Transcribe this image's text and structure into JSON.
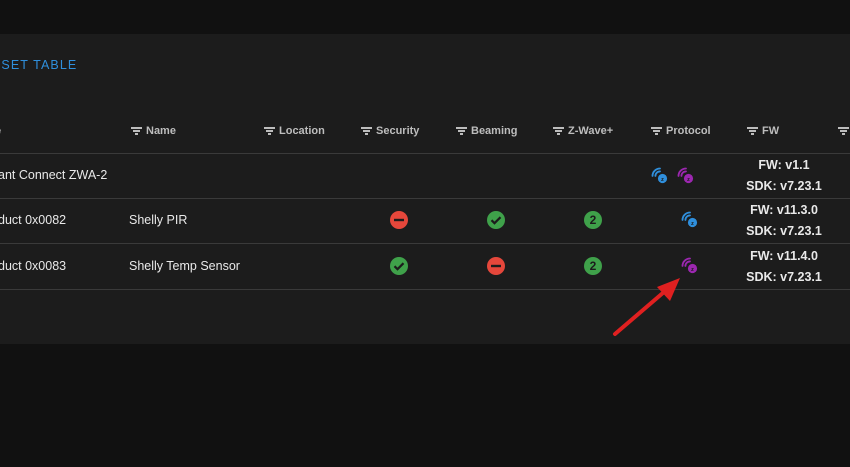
{
  "toolbar": {
    "reset_label": "ESET TABLE"
  },
  "columns": {
    "type": "e",
    "name": "Name",
    "location": "Location",
    "security": "Security",
    "beaming": "Beaming",
    "zwaveplus": "Z-Wave+",
    "protocol": "Protocol",
    "fw": "FW"
  },
  "rows": [
    {
      "type": "ant Connect ZWA-2",
      "name": "",
      "security": "",
      "beaming": "",
      "zwaveplus": "",
      "protocol": [
        "zwave-classic-icon",
        "zwave-lr-icon"
      ],
      "fw": "FW: v1.1",
      "sdk": "SDK: v7.23.1"
    },
    {
      "type": "duct 0x0082",
      "name": "Shelly PIR",
      "security": "no",
      "beaming": "yes",
      "zwaveplus": "2",
      "protocol": [
        "zwave-classic-icon"
      ],
      "fw": "FW: v11.3.0",
      "sdk": "SDK: v7.23.1"
    },
    {
      "type": "duct 0x0083",
      "name": "Shelly Temp Sensor",
      "security": "yes",
      "beaming": "no",
      "zwaveplus": "2",
      "protocol": [
        "zwave-lr-icon"
      ],
      "fw": "FW: v11.4.0",
      "sdk": "SDK: v7.23.1"
    }
  ],
  "colors": {
    "accent": "#2f8fdc",
    "yes": "#3fa14a",
    "no": "#e5473b",
    "zwave_classic": "#2f8fdc",
    "zwave_lr": "#9c27b0",
    "annotation_arrow": "#e02020"
  }
}
